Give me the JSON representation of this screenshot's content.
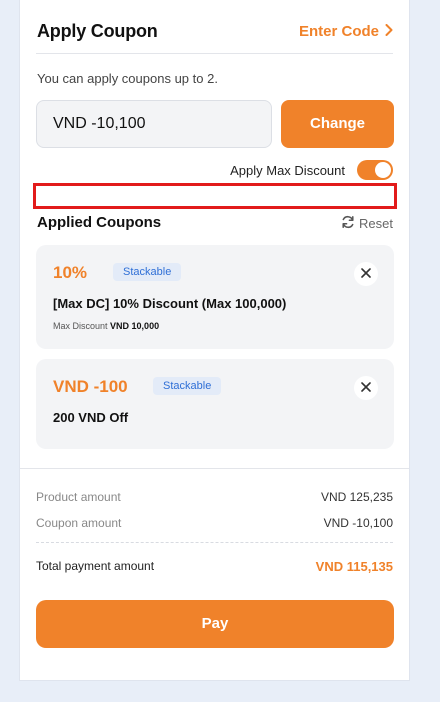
{
  "header": {
    "title": "Apply Coupon",
    "enter_code_label": "Enter Code"
  },
  "hint": "You can apply coupons up to 2.",
  "discount_input": {
    "value": "VND  -10,100"
  },
  "change_button": "Change",
  "max_discount": {
    "label": "Apply Max Discount",
    "enabled": true
  },
  "applied": {
    "title": "Applied Coupons",
    "reset_label": "Reset",
    "coupons": [
      {
        "value": "10%",
        "badge": "Stackable",
        "name": "[Max DC] 10% Discount (Max 100,000)",
        "sub_label": "Max Discount",
        "sub_value": "VND 10,000"
      },
      {
        "value": "VND -100",
        "badge": "Stackable",
        "name": "200 VND Off"
      }
    ]
  },
  "summary": {
    "product_label": "Product amount",
    "product_value": "VND 125,235",
    "coupon_label": "Coupon amount",
    "coupon_value": "VND -10,100",
    "total_label": "Total payment amount",
    "total_value": "VND 115,135"
  },
  "pay_button": "Pay",
  "colors": {
    "accent": "#f0822a",
    "badge_text": "#2f6fd6",
    "highlight": "#e21b1b"
  }
}
